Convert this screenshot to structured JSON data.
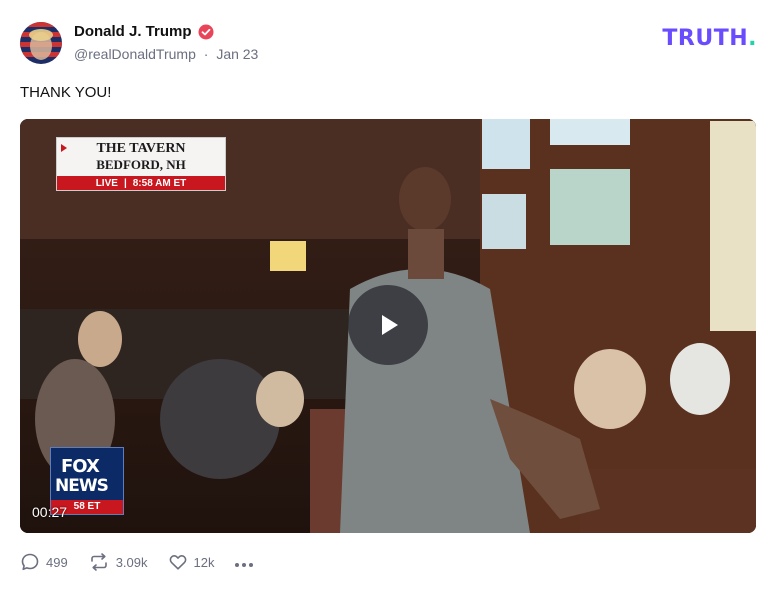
{
  "post": {
    "author_name": "Donald J. Trump",
    "handle": "@realDonaldTrump",
    "date": "Jan 23",
    "separator": "·",
    "text": "THANK YOU!"
  },
  "brand": {
    "logo_text": "TRUTH",
    "logo_accent": ".",
    "primary_color": "#6a4cff",
    "accent_color": "#22d3a8"
  },
  "video": {
    "duration": "00:27",
    "lower_third": {
      "line1": "THE TAVERN",
      "line2": "BEDFORD, NH",
      "live": "LIVE",
      "time": "8:58 AM ET"
    },
    "network_logo": {
      "line1": "FOX",
      "line2": "NEWS",
      "bar": "58 ET"
    }
  },
  "actions": {
    "replies": "499",
    "retruths": "3.09k",
    "likes": "12k"
  },
  "icons": {
    "verified": "verified-badge-icon",
    "reply": "speech-bubble-icon",
    "retruth": "repost-arrows-icon",
    "like": "heart-icon",
    "more": "ellipsis-icon",
    "play": "play-icon"
  },
  "colors": {
    "verified": "#e8445a",
    "muted_text": "#6b6f80"
  }
}
